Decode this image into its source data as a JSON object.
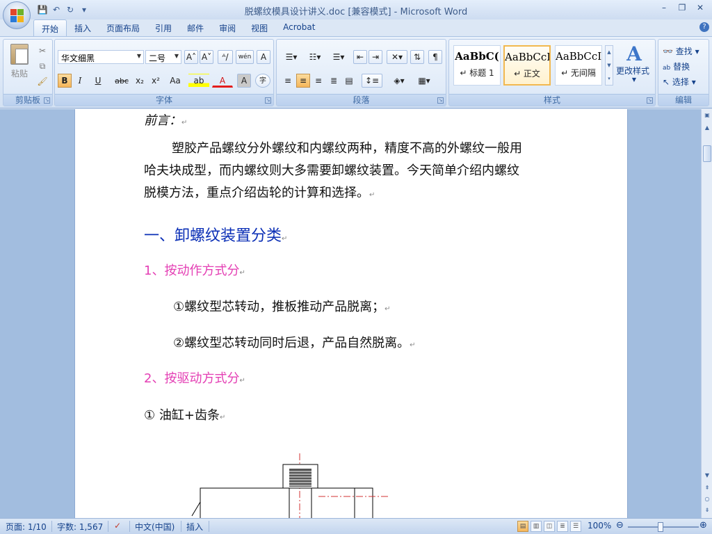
{
  "window": {
    "title": "脱螺纹模具设计讲义.doc [兼容模式] - Microsoft Word",
    "controls": [
      "–",
      "❐",
      "✕"
    ]
  },
  "qat": {
    "save": "💾",
    "undo": "↶",
    "redo": "↻",
    "customize": "▾"
  },
  "tabs": [
    "开始",
    "插入",
    "页面布局",
    "引用",
    "邮件",
    "审阅",
    "视图",
    "Acrobat"
  ],
  "help": "?",
  "ribbon": {
    "clipboard": {
      "label": "剪贴板",
      "paste": "粘贴"
    },
    "font": {
      "label": "字体",
      "font_name": "华文细黑",
      "font_size": "二号",
      "grow": "A˄",
      "shrink": "A˅",
      "clear": "ᴬ/",
      "phonetic": "wén",
      "border": "A",
      "bold": "B",
      "italic": "I",
      "underline": "U",
      "strike": "abc",
      "subscript": "x₂",
      "superscript": "x²",
      "case": "Aa",
      "highlight": "ab",
      "color": "A",
      "shade": "A",
      "enclose": "字"
    },
    "paragraph": {
      "label": "段落"
    },
    "styles": {
      "label": "样式",
      "items": [
        {
          "sample": "AaBbC(",
          "name": "↵ 标题 1"
        },
        {
          "sample": "AaBbCcI",
          "name": "↵ 正文"
        },
        {
          "sample": "AaBbCcI",
          "name": "↵ 无间隔"
        }
      ],
      "change": "更改样式"
    },
    "editing": {
      "label": "编辑",
      "find": "查找 ▾",
      "replace": "替换",
      "select": "选择 ▾"
    }
  },
  "document": {
    "lines": [
      {
        "text": "前言：",
        "mark": "↵"
      },
      {
        "text": "塑胶产品螺纹分外螺纹和内螺纹两种，精度不高的外螺纹一般用",
        "mark": ""
      },
      {
        "text": "哈夫块成型，而内螺纹则大多需要卸螺纹装置。今天简单介绍内螺纹",
        "mark": ""
      },
      {
        "text": "脱模方法，重点介绍齿轮的计算和选择。",
        "mark": "↵"
      },
      {
        "text": "一、卸螺纹装置分类",
        "mark": "↵"
      },
      {
        "text": "1、按动作方式分",
        "mark": "↵"
      },
      {
        "text": "①螺纹型芯转动，推板推动产品脱离；",
        "mark": "↵"
      },
      {
        "text": "②螺纹型芯转动同时后退，产品自然脱离。",
        "mark": "↵"
      },
      {
        "text": "2、按驱动方式分",
        "mark": "↵"
      },
      {
        "text": "① 油缸+齿条",
        "mark": "↵"
      }
    ]
  },
  "status": {
    "page": "页面: 1/10",
    "words": "字数: 1,567",
    "language": "中文(中国)",
    "mode": "插入",
    "zoom": "100%",
    "zoom_value": 100
  }
}
